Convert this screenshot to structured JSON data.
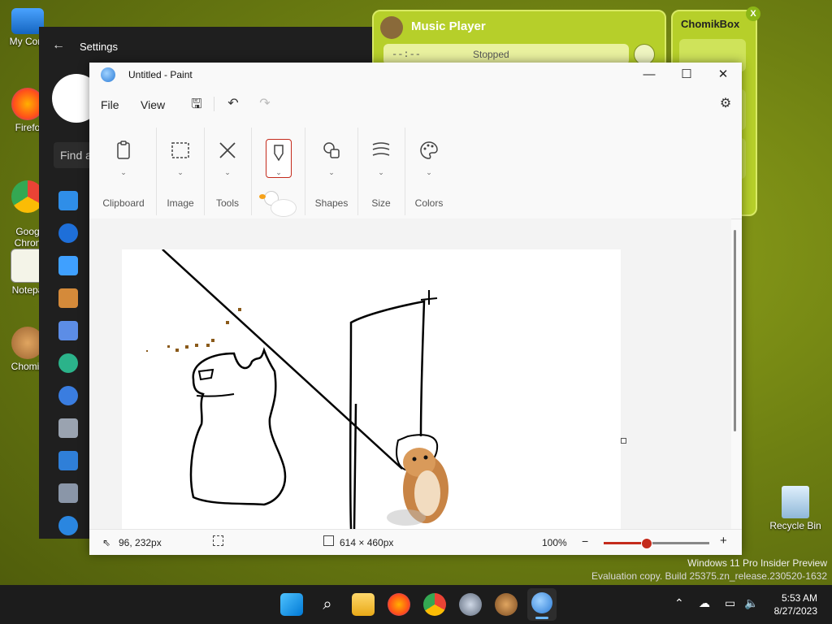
{
  "desktop": {
    "icons": [
      {
        "label": "My Com"
      },
      {
        "label": "Firefo"
      },
      {
        "label": "Goog\nChron"
      },
      {
        "label": "Notepa"
      },
      {
        "label": "Chomik"
      }
    ],
    "recycle_bin": "Recycle Bin",
    "watermark_line1": "Windows 11 Pro Insider Preview",
    "watermark_line2": "Evaluation copy. Build 25375.zn_release.230520-1632"
  },
  "settings": {
    "title": "Settings",
    "search_placeholder": "Find a"
  },
  "music_player": {
    "title": "Music Player",
    "time": "--:--",
    "status": "Stopped"
  },
  "chomikbox": {
    "title": "ChomikBox",
    "close": "X"
  },
  "paint": {
    "window_title": "Untitled - Paint",
    "menu": {
      "file": "File",
      "view": "View"
    },
    "ribbon": [
      {
        "label": "Clipboard"
      },
      {
        "label": "Image"
      },
      {
        "label": "Tools"
      },
      {
        "label": ""
      },
      {
        "label": "Shapes"
      },
      {
        "label": "Size"
      },
      {
        "label": "Colors"
      }
    ],
    "status": {
      "cursor_pos": "96, 232px",
      "canvas_size": "614 × 460px",
      "zoom": "100%",
      "zoom_fraction": 0.4
    }
  },
  "taskbar": {
    "time": "5:53 AM",
    "date": "8/27/2023"
  },
  "colors": {
    "accent": "#c42b1c",
    "taskbar": "#1c1c1c",
    "lime": "#b6cf2a"
  }
}
